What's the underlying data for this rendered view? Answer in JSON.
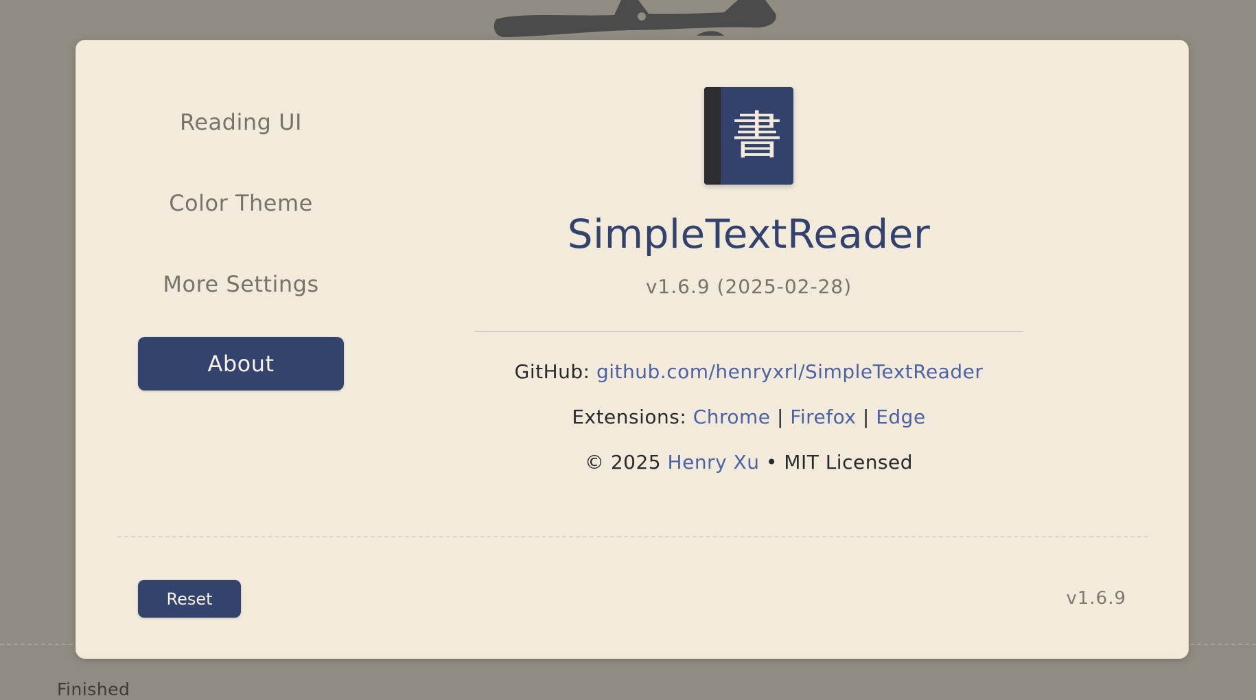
{
  "background": {
    "status_text": "Finished"
  },
  "sidebar": {
    "items": [
      {
        "label": "Reading UI",
        "active": false
      },
      {
        "label": "Color Theme",
        "active": false
      },
      {
        "label": "More Settings",
        "active": false
      },
      {
        "label": "About",
        "active": true
      }
    ]
  },
  "about": {
    "icon_glyph": "書",
    "icon_name": "book-icon",
    "app_name": "SimpleTextReader",
    "version_full": "v1.6.9 (2025-02-28)",
    "github_label": "GitHub:",
    "github_link": "github.com/henryxrl/SimpleTextReader",
    "extensions_label": "Extensions:",
    "extensions": [
      "Chrome",
      "Firefox",
      "Edge"
    ],
    "separator": "|",
    "copyright_prefix": "© 2025",
    "author": "Henry Xu",
    "license": "• MIT Licensed"
  },
  "footer": {
    "reset_label": "Reset",
    "version": "v1.6.9"
  },
  "colors": {
    "accent": "#33436d",
    "link": "#4d62a3",
    "panel": "#f2ebdb",
    "backdrop": "#908c82"
  }
}
